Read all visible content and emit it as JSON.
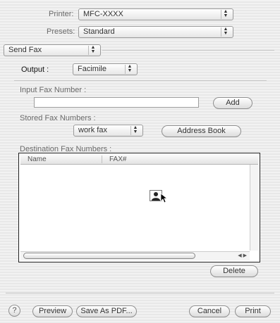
{
  "printer": {
    "label": "Printer:",
    "value": "MFC-XXXX"
  },
  "presets": {
    "label": "Presets:",
    "value": "Standard"
  },
  "section": {
    "value": "Send Fax"
  },
  "output": {
    "label": "Output :",
    "value": "Facimile"
  },
  "input_fax": {
    "label": "Input Fax Number :",
    "value": "",
    "add_label": "Add"
  },
  "stored": {
    "label": "Stored Fax Numbers :",
    "value": "work fax",
    "address_book_label": "Address Book"
  },
  "destination": {
    "label": "Destination Fax Numbers :",
    "columns": [
      "Name",
      "FAX#"
    ],
    "delete_label": "Delete"
  },
  "footer": {
    "help_label": "?",
    "preview_label": "Preview",
    "save_pdf_label": "Save As PDF...",
    "cancel_label": "Cancel",
    "print_label": "Print"
  }
}
